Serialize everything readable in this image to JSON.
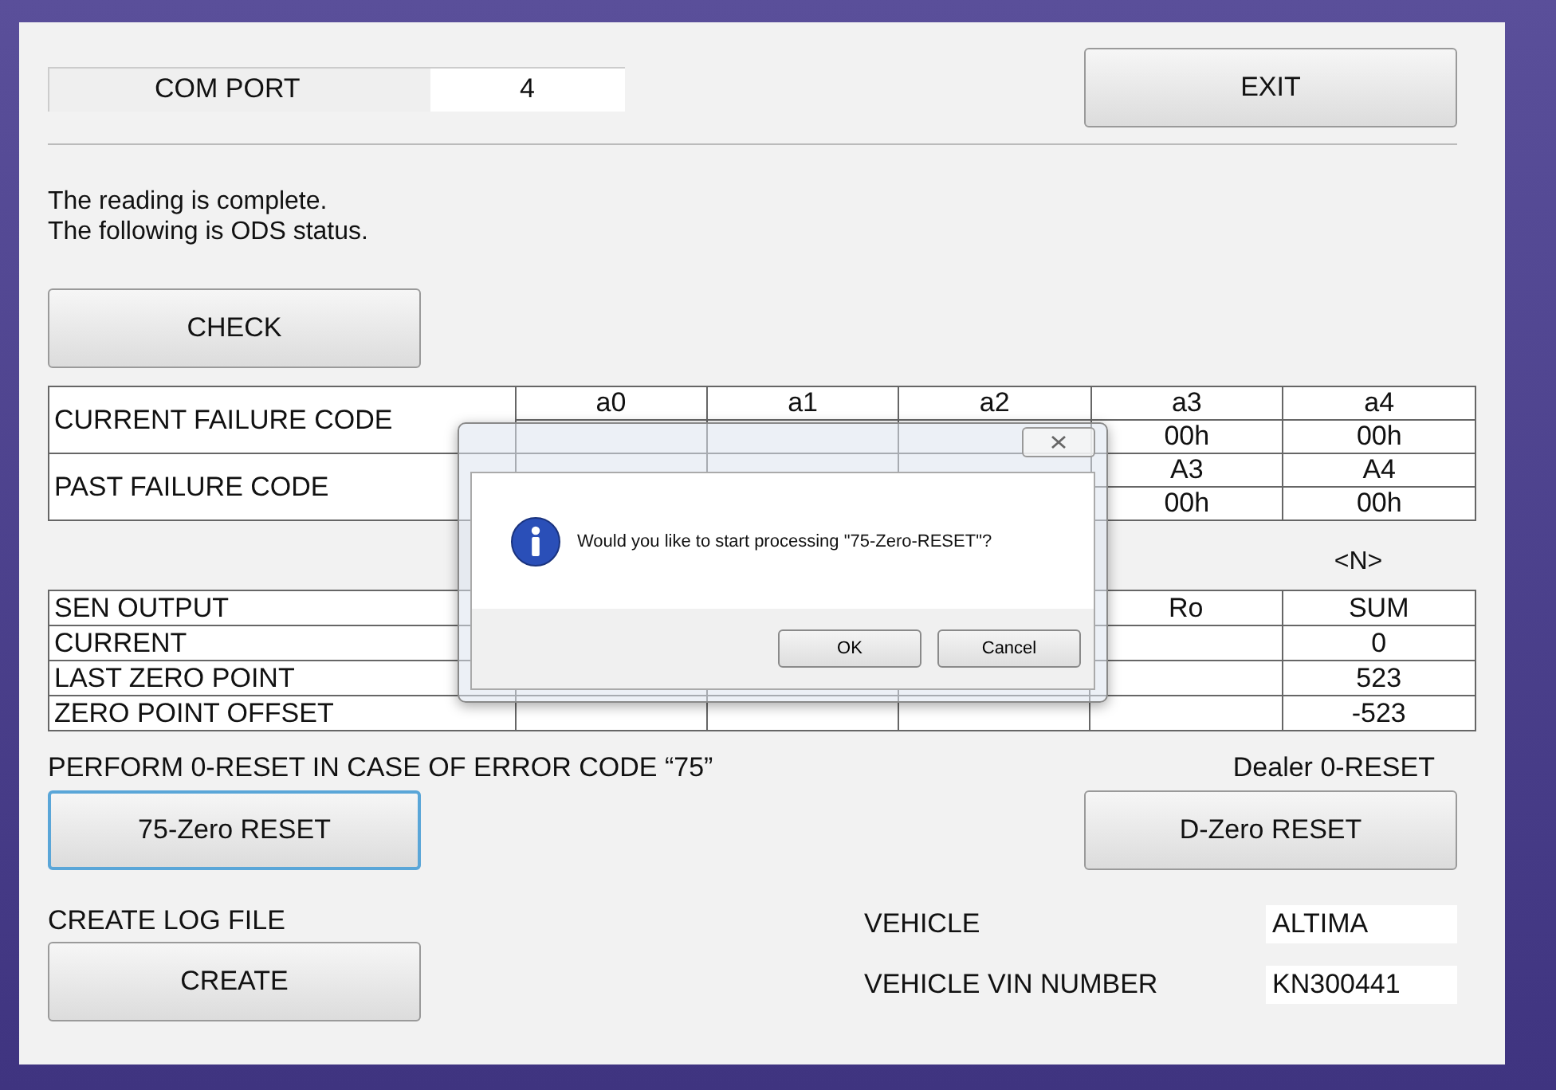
{
  "com_port": {
    "label": "COM PORT",
    "value": "4"
  },
  "exit_button": "EXIT",
  "message": [
    "The reading is complete.",
    "The following is ODS status."
  ],
  "check_button": "CHECK",
  "failure_table": [
    {
      "label": "CURRENT FAILURE CODE",
      "codes": [
        "a0",
        "a1",
        "a2",
        "a3",
        "a4"
      ],
      "values": [
        "00h",
        "00h"
      ]
    },
    {
      "label": "PAST FAILURE CODE",
      "codes": [
        "A3",
        "A4"
      ],
      "values": [
        "00h",
        "00h"
      ]
    }
  ],
  "unit_label": "<N>",
  "sensor_table": [
    {
      "label": "SEN OUTPUT",
      "cells": [
        "Ro",
        "SUM"
      ]
    },
    {
      "label": "CURRENT",
      "cells": [
        "0"
      ]
    },
    {
      "label": "LAST ZERO POINT",
      "cells": [
        "523"
      ]
    },
    {
      "label": "ZERO POINT OFFSET",
      "cells": [
        "-523"
      ]
    }
  ],
  "zero_reset": {
    "caption": "PERFORM 0-RESET IN CASE OF ERROR CODE “75”",
    "button": "75-Zero RESET",
    "focused": true
  },
  "dealer_reset": {
    "caption": "Dealer 0-RESET",
    "button": "D-Zero RESET",
    "focused": false
  },
  "log_file": {
    "caption": "CREATE LOG FILE",
    "button": "CREATE"
  },
  "vehicle": [
    {
      "label": "VEHICLE",
      "value": "ALTIMA"
    },
    {
      "label": "VEHICLE VIN NUMBER",
      "value": "KN300441"
    }
  ],
  "dialog": {
    "message": "Would you like to start processing \"75-Zero-RESET\"?",
    "buttons": [
      "OK",
      "Cancel"
    ]
  }
}
